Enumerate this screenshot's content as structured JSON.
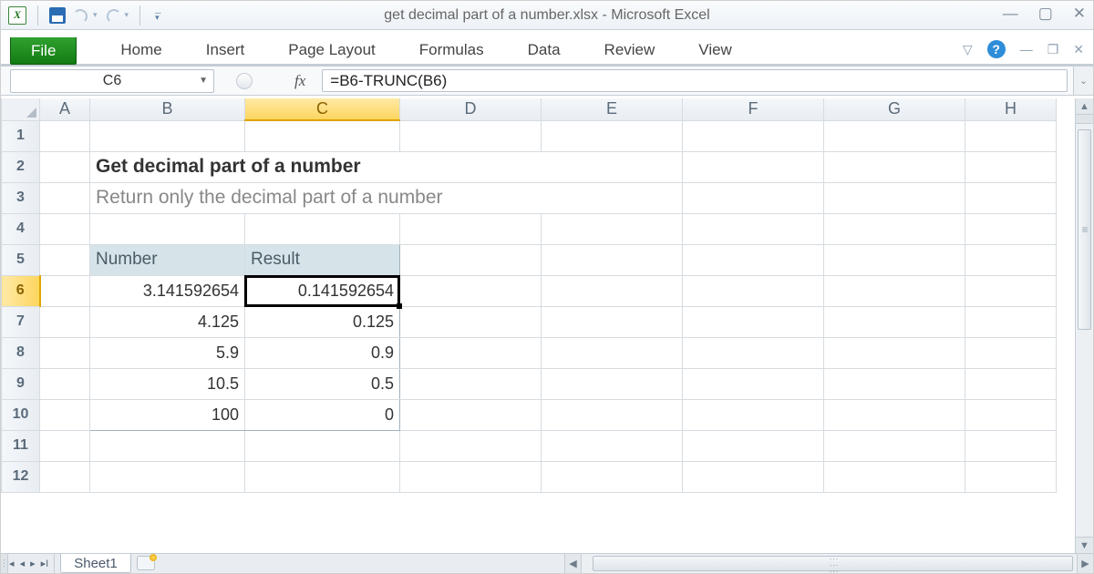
{
  "titlebar": {
    "title": "get decimal part of a number.xlsx  -  Microsoft Excel"
  },
  "ribbon": {
    "file": "File",
    "tabs": [
      "Home",
      "Insert",
      "Page Layout",
      "Formulas",
      "Data",
      "Review",
      "View"
    ]
  },
  "formula_bar": {
    "namebox": "C6",
    "fx": "fx",
    "formula": "=B6-TRUNC(B6)"
  },
  "columns": [
    "A",
    "B",
    "C",
    "D",
    "E",
    "F",
    "G",
    "H"
  ],
  "rows": [
    "1",
    "2",
    "3",
    "4",
    "5",
    "6",
    "7",
    "8",
    "9",
    "10",
    "11",
    "12"
  ],
  "content": {
    "title": "Get decimal part of a number",
    "subtitle": "Return only the decimal part of a number",
    "header_number": "Number",
    "header_result": "Result",
    "data": [
      {
        "number": "3.141592654",
        "result": "0.141592654"
      },
      {
        "number": "4.125",
        "result": "0.125"
      },
      {
        "number": "5.9",
        "result": "0.9"
      },
      {
        "number": "10.5",
        "result": "0.5"
      },
      {
        "number": "100",
        "result": "0"
      }
    ]
  },
  "active": {
    "col": "C",
    "row": "6"
  },
  "sheet_tab": "Sheet1"
}
